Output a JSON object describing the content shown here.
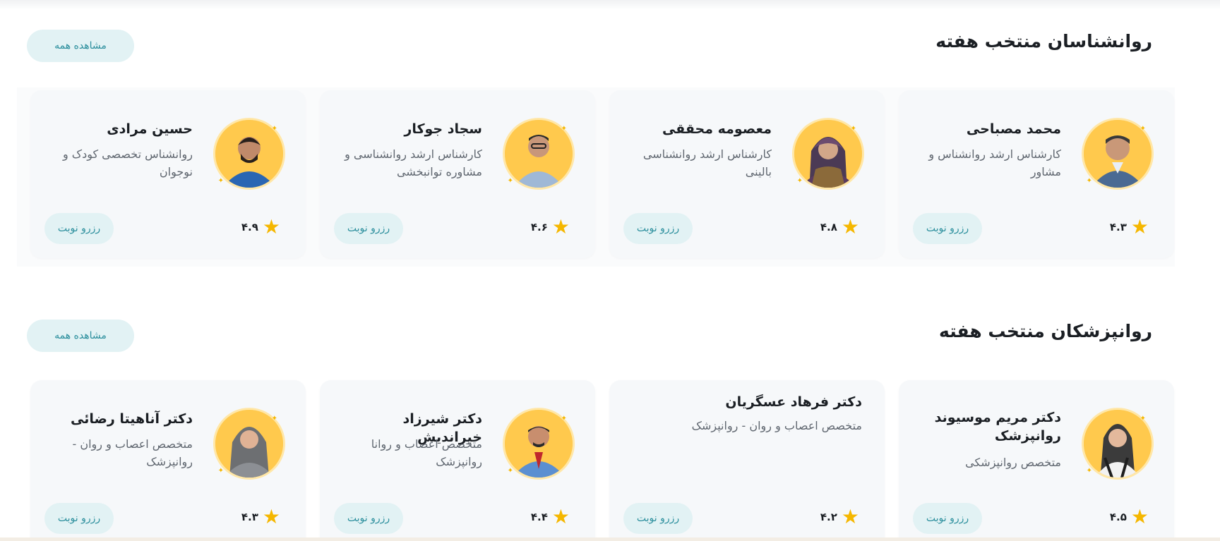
{
  "psychologists": {
    "title": "روانشناسان منتخب هفته",
    "view_all": "مشاهده همه",
    "cards": [
      {
        "name": "محمد مصباحی",
        "desc": "کارشناس ارشد روانشناس و مشاور",
        "rating": "۴.۳",
        "book": "رزرو نوبت"
      },
      {
        "name": "معصومه محققی",
        "desc": "کارشناس ارشد روانشناسی بالینی",
        "rating": "۴.۸",
        "book": "رزرو نوبت"
      },
      {
        "name": "سجاد جوکار",
        "desc": "کارشناس ارشد روانشناسی و مشاوره توانبخشی",
        "rating": "۴.۶",
        "book": "رزرو نوبت"
      },
      {
        "name": "حسین مرادی",
        "desc": "روانشناس تخصصی کودک و نوجوان",
        "rating": "۴.۹",
        "book": "رزرو نوبت"
      }
    ]
  },
  "psychiatrists": {
    "title": "روانپزشکان منتخب هفته",
    "view_all": "مشاهده همه",
    "cards": [
      {
        "name": "دکتر مریم موسیوند روانپزشک",
        "desc": "متخصص روانپزشکی",
        "rating": "۴.۵",
        "book": "رزرو نوبت"
      },
      {
        "name": "دکتر فرهاد عسگریان",
        "desc": "متخصص اعصاب و روان - روانپزشک",
        "rating": "۴.۲",
        "book": "رزرو نوبت"
      },
      {
        "name": "دکتر شیرزاد خیراندیش",
        "desc": "متخصص اعصاب و روانا روانپزشک",
        "rating": "۴.۴",
        "book": "رزرو نوبت"
      },
      {
        "name": "دکتر آناهیتا رضائی",
        "desc": "متخصص اعصاب و روان - روانپزشک",
        "rating": "۴.۳",
        "book": "رزرو نوبت"
      }
    ]
  },
  "colors": {
    "accent": "#2c8f9d",
    "button_bg": "#e2f2f4",
    "star": "#f5b700",
    "avatar_bg": "#ffc94d"
  },
  "icons": {
    "rating": "star-icon",
    "avatar_decoration": "sparkle-icon"
  }
}
